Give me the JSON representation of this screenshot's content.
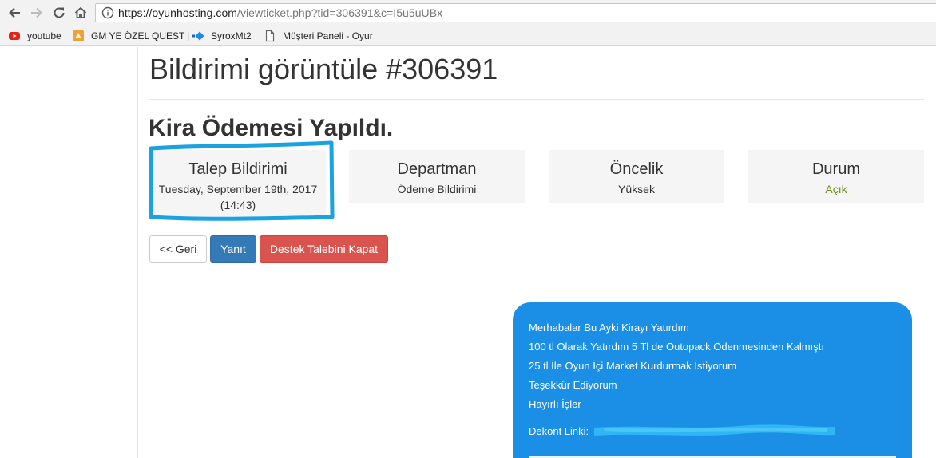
{
  "browser": {
    "url_host": "https://oyunhosting.com",
    "url_path": "/viewticket.php?tid=306391&c=I5u5uUBx",
    "bookmarks": [
      {
        "label": "youtube",
        "icon": "youtube-icon"
      },
      {
        "label": "GM YE ÖZEL QUEST",
        "icon": "quest-icon"
      },
      {
        "label": "SyroxMt2",
        "icon": "syrox-icon"
      },
      {
        "label": "Müşteri Paneli - Oyur",
        "icon": "page-icon"
      }
    ]
  },
  "page": {
    "title": "Bildirimi görüntüle #306391",
    "subject": "Kira Ödemesi Yapıldı."
  },
  "stats": {
    "date_label": "Talep Bildirimi",
    "date_value": "Tuesday, September 19th, 2017",
    "date_time": "(14:43)",
    "department_label": "Departman",
    "department_value": "Ödeme Bildirimi",
    "priority_label": "Öncelik",
    "priority_value": "Yüksek",
    "status_label": "Durum",
    "status_value": "Açık"
  },
  "actions": {
    "back": "<< Geri",
    "reply": "Yanıt",
    "close": "Destek Talebini Kapat"
  },
  "message": {
    "lines": [
      "Merhabalar Bu Ayki Kirayı Yatırdım",
      "100 tl Olarak Yatırdım 5 Tl de Outopack Ödenmesinden Kalmıştı",
      "25 tl İle Oyun İçi Market Kurdurmak İstiyorum",
      "Teşekkür Ediyorum",
      "Hayırlı İşler"
    ],
    "receipt_label": "Dekont Linki:"
  },
  "colors": {
    "reply_button": "#337ab7",
    "close_button": "#d9534f",
    "status_open": "#6b8e23",
    "message_bubble": "#1b8fe6",
    "highlight_marker": "#1aa3e0"
  }
}
